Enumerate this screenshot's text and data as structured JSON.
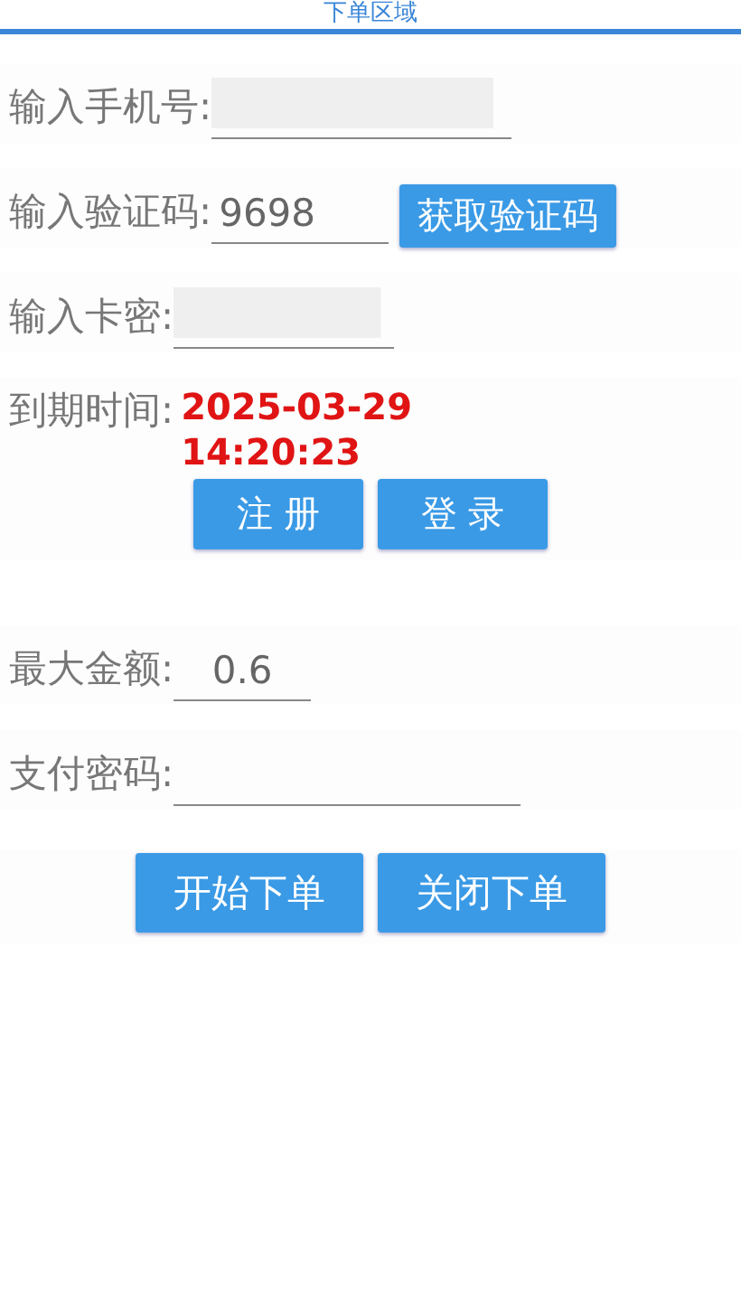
{
  "header": {
    "title": "下单区域"
  },
  "login_fields": [
    {
      "label": "输入手机号:",
      "shaded": true,
      "kind": "input"
    },
    {
      "label": "输入验证码:",
      "value": "9698",
      "shaded": false,
      "kind": "code",
      "button": "获取验证码"
    },
    {
      "label": "输入卡密:",
      "shaded": true,
      "kind": "input"
    }
  ],
  "expiry": {
    "label": "到期时间:",
    "value": "2025-03-29 14:20:23"
  },
  "login_buttons": [
    "注 册",
    "登 录"
  ],
  "order_fields": [
    {
      "label": "最大金额:",
      "value": "0.6"
    },
    {
      "label": "支付密码:"
    }
  ],
  "order_buttons": [
    "开始下单",
    "关闭下单"
  ]
}
